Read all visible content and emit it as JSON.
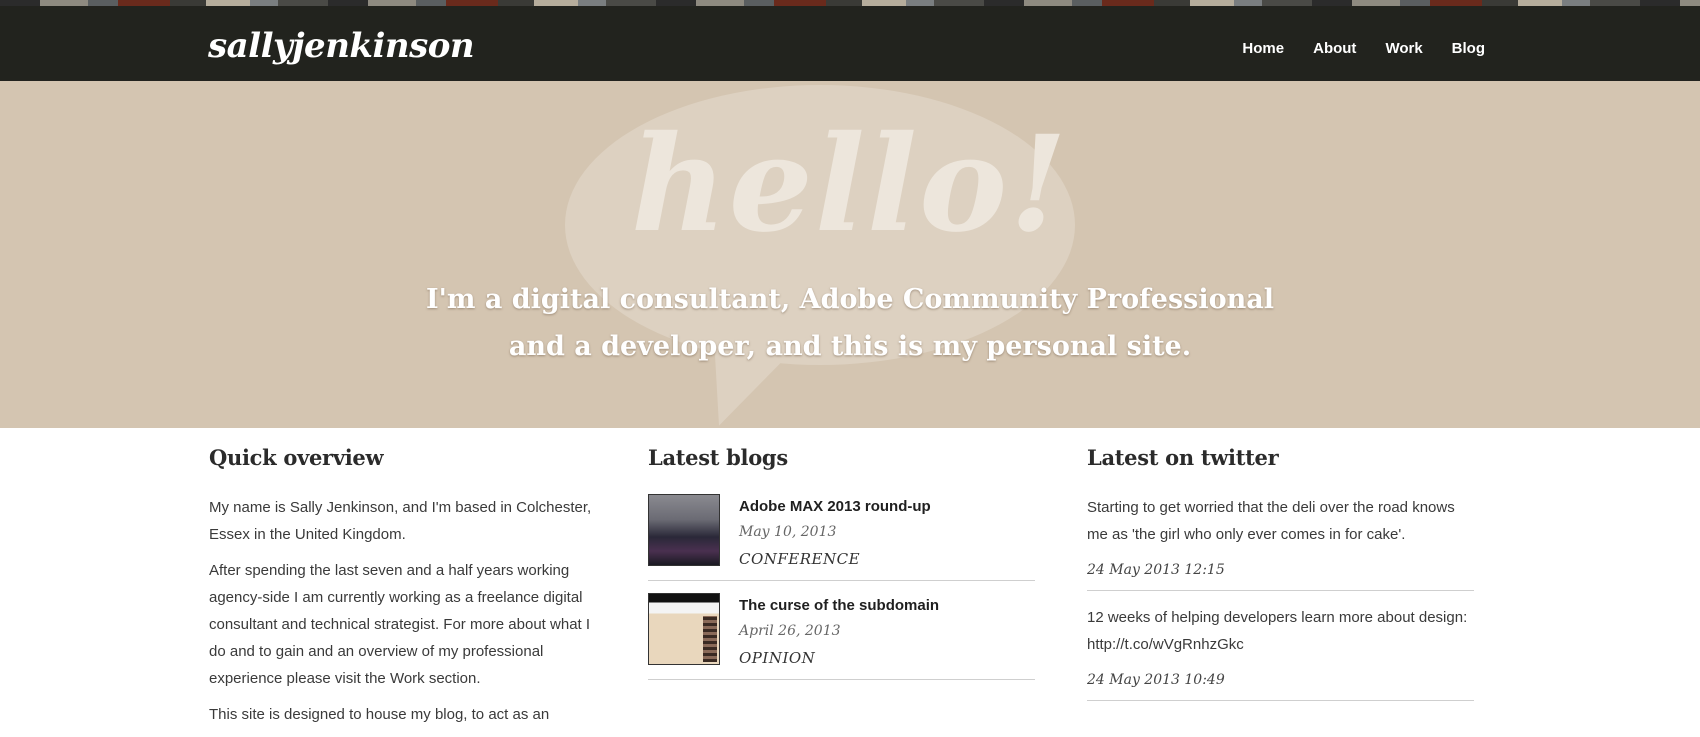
{
  "stripe_colors": [
    "#2b2b2b",
    "#8e8a80",
    "#5a5e60",
    "#6a2a1c",
    "#3a3a36",
    "#b6ad9c",
    "#7a7e80",
    "#4a4a46"
  ],
  "header": {
    "logo": "sallyjenkinson",
    "nav": [
      {
        "label": "Home"
      },
      {
        "label": "About"
      },
      {
        "label": "Work"
      },
      {
        "label": "Blog"
      }
    ]
  },
  "hero": {
    "hello": "hello!",
    "tagline_line1": "I'm a digital consultant, Adobe Community Professional",
    "tagline_line2": "and a developer, and this is my personal site."
  },
  "overview": {
    "heading": "Quick overview",
    "paragraphs": [
      "My name is Sally Jenkinson, and I'm based in Colchester, Essex in the United Kingdom.",
      "After spending the last seven and a half years working agency-side I am currently working as a freelance digital consultant and technical strategist. For more about what I do and to gain and an overview of my professional experience please visit the Work section.",
      "This site is designed to house my blog, to act as an"
    ]
  },
  "blogs": {
    "heading": "Latest blogs",
    "items": [
      {
        "title": "Adobe MAX 2013 round-up",
        "date": "May 10, 2013",
        "category": "CONFERENCE"
      },
      {
        "title": "The curse of the subdomain",
        "date": "April 26, 2013",
        "category": "OPINION"
      }
    ]
  },
  "twitter": {
    "heading": "Latest on twitter",
    "tweets": [
      {
        "text": "Starting to get worried that the deli over the road knows me as 'the girl who only ever comes in for cake'.",
        "time": "24 May 2013 12:15"
      },
      {
        "text": "12 weeks of helping developers learn more about design: http://t.co/wVgRnhzGkc",
        "time": "24 May 2013 10:49"
      }
    ]
  }
}
